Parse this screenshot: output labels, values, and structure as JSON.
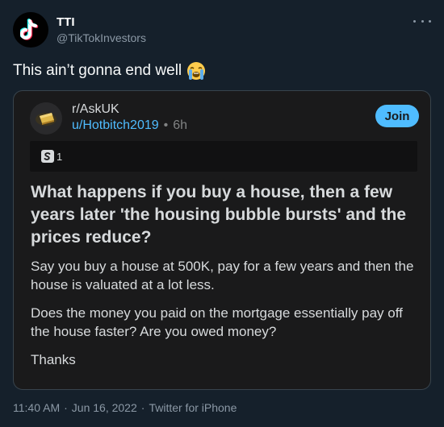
{
  "author": {
    "name": "TTI",
    "handle": "@TikTokInvestors"
  },
  "tweet": {
    "text": "This ain’t gonna end well",
    "emoji": "loudly-crying-face"
  },
  "quote": {
    "subreddit": "r/AskUK",
    "username": "u/Hotbitch2019",
    "separator": "•",
    "time_ago": "6h",
    "join_label": "Join",
    "award_count": "1",
    "title": "What happens if you buy a house, then a few years later 'the housing bubble bursts' and the prices reduce?",
    "body": [
      "Say you buy a house at 500K, pay for a few years and then the house is valuated at a lot less.",
      "Does the money you paid on the mortgage essentially pay off the house faster? Are you owed money?",
      "Thanks"
    ]
  },
  "footer": {
    "time": "11:40 AM",
    "date": "Jun 16, 2022",
    "sep": "·",
    "source": "Twitter for iPhone"
  },
  "colors": {
    "background": "#15202b",
    "card": "#1a1a1b",
    "accent": "#4fbcff",
    "muted": "#8b98a5"
  }
}
